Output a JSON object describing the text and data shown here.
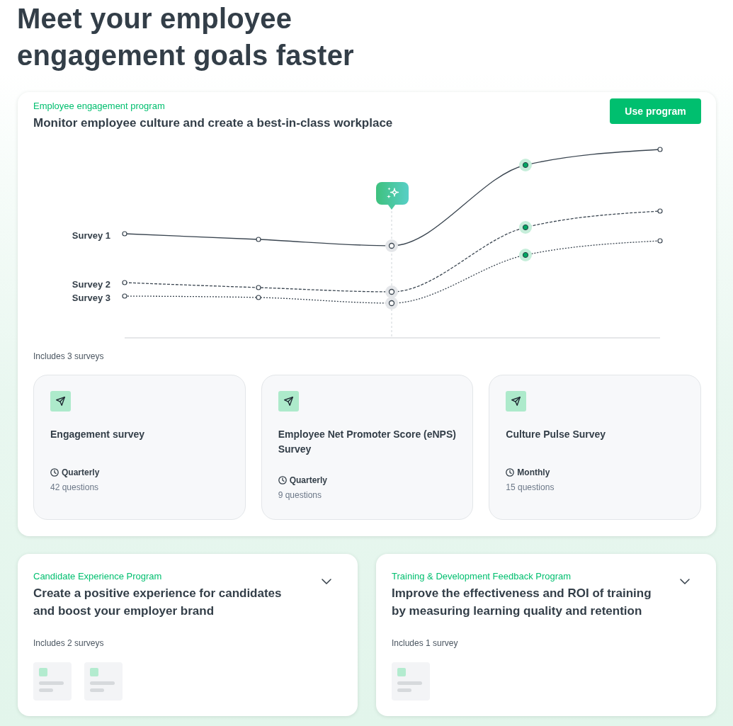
{
  "heading": "Meet your employee engagement goals faster",
  "featured_program": {
    "label": "Employee engagement program",
    "title": "Monitor employee culture and create a best-in-class workplace",
    "button": "Use program",
    "chart": {
      "series": [
        {
          "name": "Survey 1",
          "kind": "solid"
        },
        {
          "name": "Survey 2",
          "kind": "dashed"
        },
        {
          "name": "Survey 3",
          "kind": "dotted"
        }
      ]
    },
    "includes": "Includes 3 surveys",
    "surveys": [
      {
        "title": "Engagement survey",
        "frequency": "Quarterly",
        "questions": "42 questions"
      },
      {
        "title": "Employee Net Promoter Score (eNPS) Survey",
        "frequency": "Quarterly",
        "questions": "9 questions"
      },
      {
        "title": "Culture Pulse Survey",
        "frequency": "Monthly",
        "questions": "15 questions"
      }
    ]
  },
  "other_programs": [
    {
      "label": "Candidate Experience Program",
      "title": "Create a positive experience for candidates and boost your employer brand",
      "expanded": false,
      "includes": "Includes 2 surveys",
      "surveys": [
        {
          "kind": "placeholder"
        },
        {
          "kind": "placeholder"
        }
      ]
    },
    {
      "label": "Training & Development Feedback Program",
      "title": "Improve the effectiveness and ROI of training by measuring learning quality and retention",
      "expanded": false,
      "includes": "Includes 1 survey",
      "surveys": [
        {
          "kind": "placeholder"
        }
      ]
    }
  ]
}
